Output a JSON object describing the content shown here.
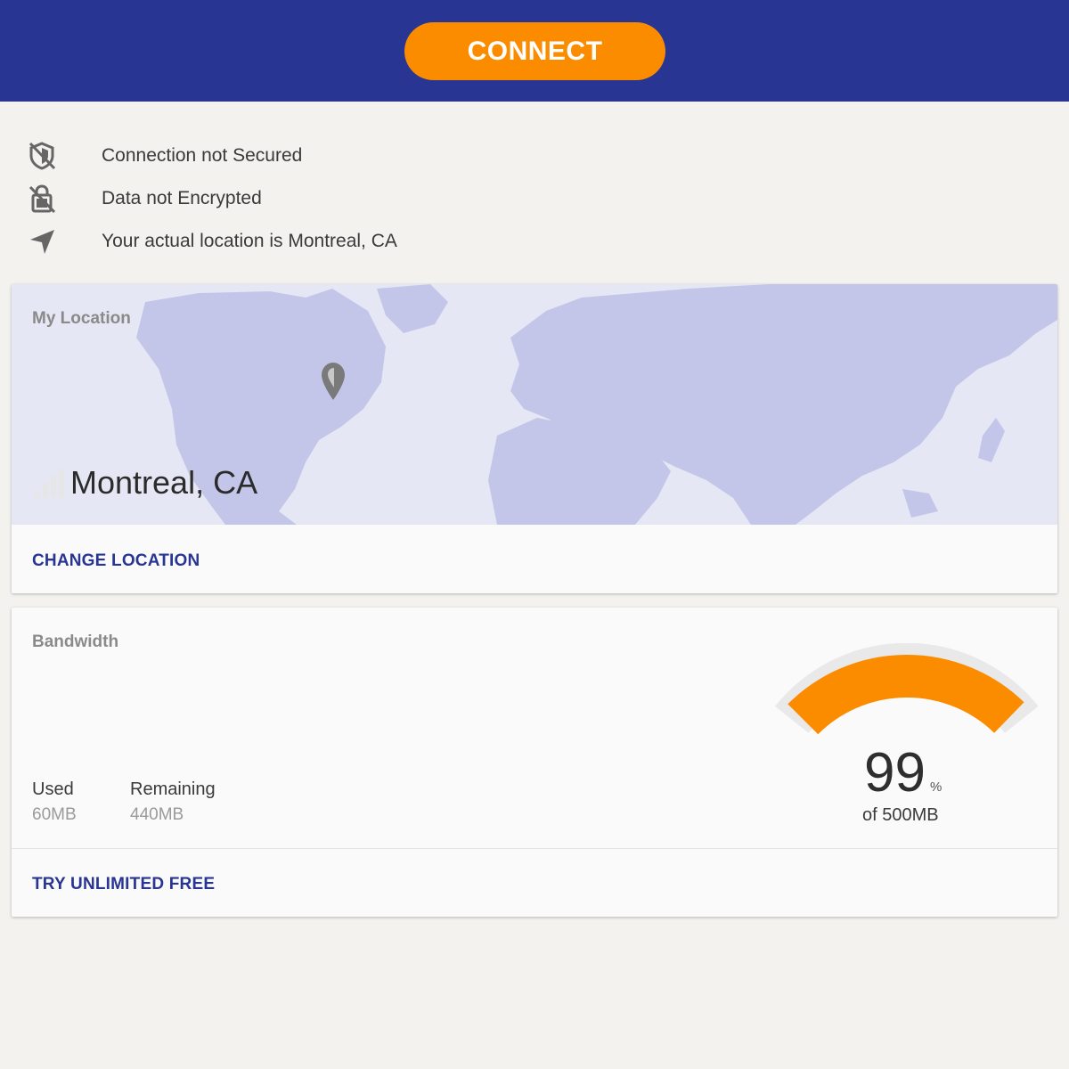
{
  "header": {
    "connect_label": "CONNECT",
    "background_color": "#283593",
    "button_color": "#fb8c00"
  },
  "status": [
    {
      "icon": "shield-off-icon",
      "text": "Connection not Secured"
    },
    {
      "icon": "lock-off-icon",
      "text": "Data not Encrypted"
    },
    {
      "icon": "location-arrow-icon",
      "text": "Your actual location is Montreal, CA"
    }
  ],
  "location_card": {
    "label": "My Location",
    "location": "Montreal, CA",
    "action": "CHANGE LOCATION",
    "map_color": "#c3c6e8",
    "pin_icon": "map-pin-icon",
    "signal_icon": "signal-bars-icon"
  },
  "bandwidth_card": {
    "label": "Bandwidth",
    "used_label": "Used",
    "used_value": "60MB",
    "remaining_label": "Remaining",
    "remaining_value": "440MB",
    "percent": "99",
    "percent_sign": "%",
    "of_total": "of 500MB",
    "gauge_fill_fraction": 0.99,
    "gauge_color": "#fb8c00",
    "action": "TRY UNLIMITED FREE"
  }
}
